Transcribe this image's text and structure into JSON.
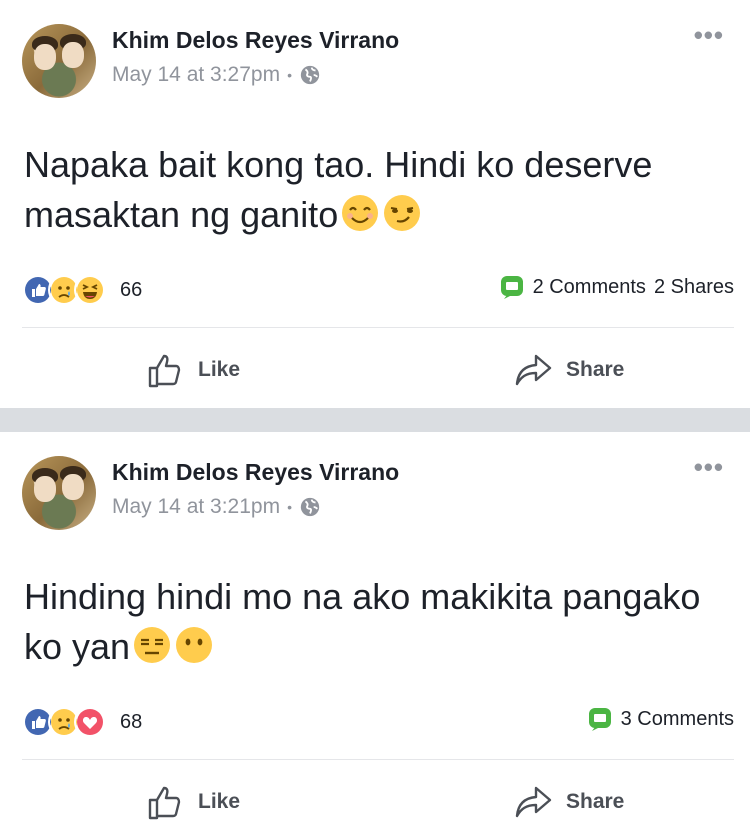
{
  "posts": [
    {
      "author": "Khim Delos Reyes Virrano",
      "timestamp": "May 14 at 3:27pm",
      "privacy_icon": "globe-icon",
      "text": "Napaka bait kong tao. Hindi ko deserve masaktan ng ganito",
      "text_emojis": [
        "smiling-face-icon",
        "smirking-face-icon"
      ],
      "reactions": [
        "like",
        "sad",
        "haha"
      ],
      "reaction_count": "66",
      "comments_label": "2 Comments",
      "shares_label": "2 Shares",
      "like_label": "Like",
      "share_label": "Share"
    },
    {
      "author": "Khim Delos Reyes Virrano",
      "timestamp": "May 14 at 3:21pm",
      "privacy_icon": "globe-icon",
      "text": "Hinding hindi mo na ako makikita pangako ko yan",
      "text_emojis": [
        "expressionless-face-icon",
        "face-without-mouth-icon"
      ],
      "reactions": [
        "like",
        "sad",
        "love"
      ],
      "reaction_count": "68",
      "comments_label": "3 Comments",
      "shares_label": "",
      "like_label": "Like",
      "share_label": "Share"
    }
  ],
  "colors": {
    "like_blue": "#4267b2",
    "love_red": "#f25268",
    "emoji_yellow": "#ffcc4d",
    "comment_green": "#4bb543",
    "meta_gray": "#90949c",
    "separator": "#dadde1"
  }
}
